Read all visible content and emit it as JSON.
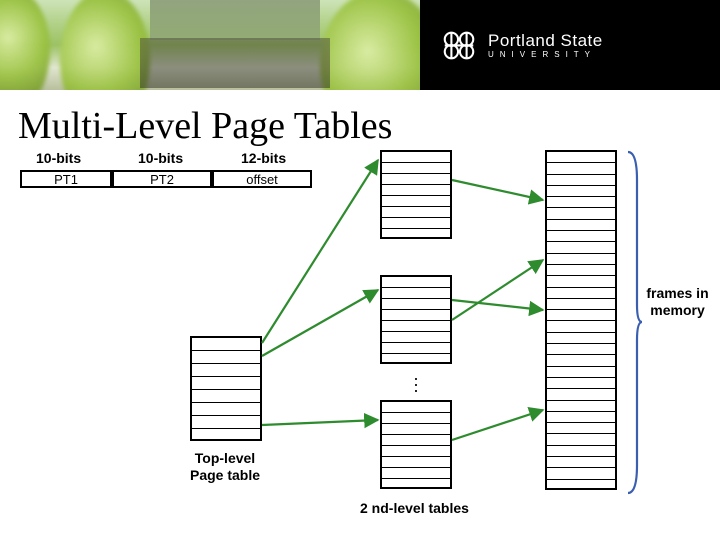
{
  "institution": {
    "name": "Portland State",
    "subtitle": "UNIVERSITY"
  },
  "title": "Multi-Level Page Tables",
  "address_fields": [
    {
      "bits": "10-bits",
      "name": "PT1"
    },
    {
      "bits": "10-bits",
      "name": "PT2"
    },
    {
      "bits": "12-bits",
      "name": "offset"
    }
  ],
  "labels": {
    "top_level": "Top-level\nPage table",
    "second_level": "2 nd-level tables",
    "frames": "frames in memory"
  },
  "structure": {
    "top_level_table": {
      "rows": 8
    },
    "second_level_tables": [
      {
        "rows": 8
      },
      {
        "rows": 8
      },
      {
        "rows": 8
      }
    ],
    "memory_frames": {
      "rows": 30
    }
  }
}
